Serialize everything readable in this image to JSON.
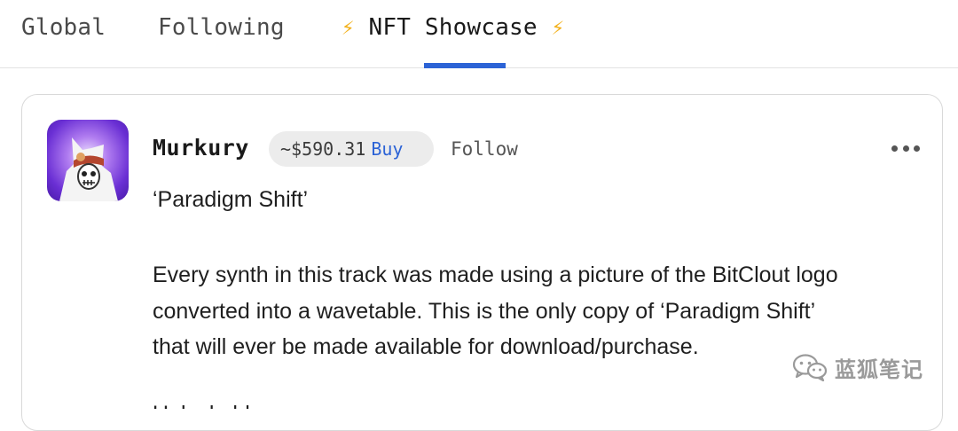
{
  "tabs": [
    {
      "label": "Global"
    },
    {
      "label": "Following"
    },
    {
      "label": "NFT Showcase",
      "icon": "lightning-bolt-icon",
      "active": true
    }
  ],
  "bolt_glyph": "⚡",
  "colors": {
    "accent": "#2c63d6",
    "bolt": "#f3b21f"
  },
  "post": {
    "username": "Murkury",
    "coin_price": "~$590.31",
    "buy_label": "Buy",
    "follow_label": "Follow",
    "title": "‘Paradigm Shift’",
    "body_lines": [
      "Every synth in this track was made using a picture of the BitClout logo",
      "converted into a wavetable. This is the only copy of ‘Paradigm Shift’",
      "that will ever be made available for download/purchase."
    ],
    "next_line_partial": "Unlockable"
  },
  "watermark": {
    "text": "蓝狐笔记",
    "icon": "wechat-icon"
  }
}
